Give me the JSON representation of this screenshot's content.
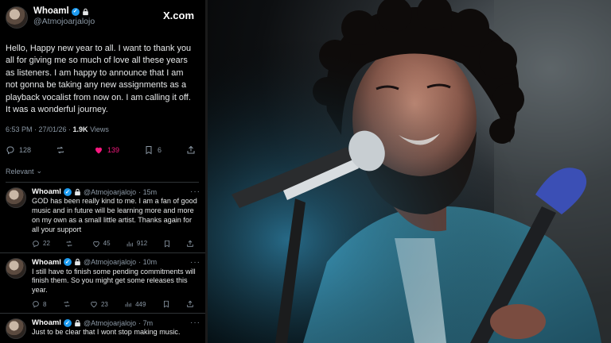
{
  "post": {
    "display_name": "Whoaml",
    "handle": "@Atmojoarjalojo",
    "brand": "X.com",
    "text": "Hello, Happy new year to all. I want to thank you all for giving me so much of love all these years as listeners. I am happy to announce that I am not gonna be taking any new assignments as a playback vocalist from now on. I am calling it off. It was a wonderful journey.",
    "time": "6:53 PM · 27/01/26 · ",
    "views_count": "1.9K",
    "views_label": " Views",
    "replies": "128",
    "reposts": "",
    "likes": "139",
    "bookmarks": "6"
  },
  "relevant_label": "Relevant",
  "replies": [
    {
      "display_name": "Whoaml",
      "handle": "@Atmojoarjalojo",
      "age": "· 15m",
      "text": "GOD has been really kind to me. I am a fan of good music and in future will be learning more and more on my own as a small little artist. Thanks again for all your support",
      "replies": "22",
      "reposts": "",
      "likes": "45",
      "views": "912"
    },
    {
      "display_name": "Whoaml",
      "handle": "@Atmojoarjalojo",
      "age": "· 10m",
      "text": "I still have to finish some pending commitments will finish them. So you might get some releases this year.",
      "replies": "8",
      "reposts": "",
      "likes": "23",
      "views": "449"
    },
    {
      "display_name": "Whoaml",
      "handle": "@Atmojoarjalojo",
      "age": "· 7m",
      "text": "Just to be clear that I wont stop making music.",
      "replies": "",
      "reposts": "",
      "likes": "",
      "views": ""
    }
  ],
  "colors": {
    "accent": "#1d9bf0",
    "like": "#f91880",
    "muted": "#8b98a5"
  },
  "icons": [
    "verified-icon",
    "lock-icon",
    "reply-icon",
    "repost-icon",
    "heart-icon",
    "bookmark-icon",
    "share-icon",
    "views-icon",
    "more-icon",
    "chevron-down-icon"
  ]
}
